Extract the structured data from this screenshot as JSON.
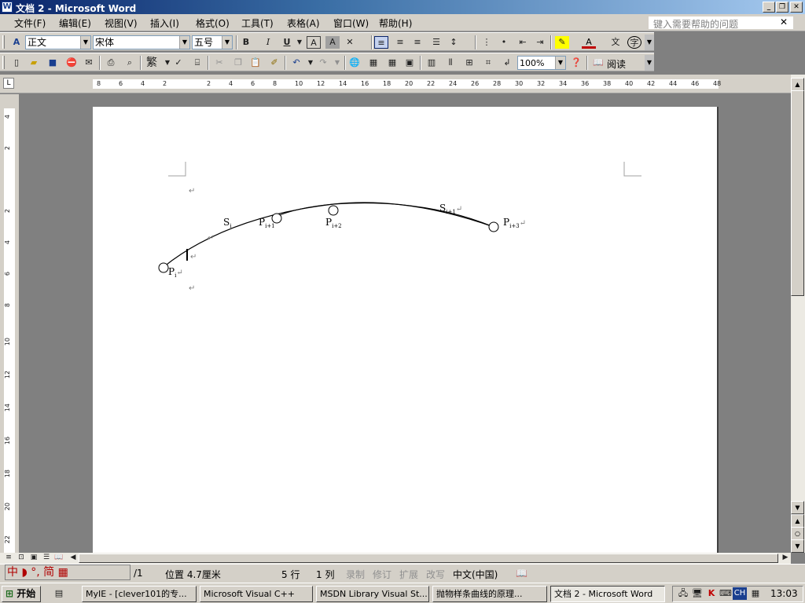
{
  "window": {
    "title": "文档 2 - Microsoft Word"
  },
  "menu": {
    "items": [
      "文件(F)",
      "编辑(E)",
      "视图(V)",
      "插入(I)",
      "格式(O)",
      "工具(T)",
      "表格(A)",
      "窗口(W)",
      "帮助(H)"
    ],
    "help_placeholder": "键入需要帮助的问题"
  },
  "format_toolbar": {
    "style": "正文",
    "font": "宋体",
    "size": "五号",
    "bold": "B",
    "italic": "I",
    "underline": "U"
  },
  "std_toolbar": {
    "zoom": "100%",
    "read": "阅读",
    "trad": "繁"
  },
  "ruler": {
    "h_ticks": [
      "8",
      "6",
      "4",
      "2",
      "2",
      "4",
      "6",
      "8",
      "10",
      "12",
      "14",
      "16",
      "18",
      "20",
      "22",
      "24",
      "26",
      "28",
      "30",
      "32",
      "34",
      "36",
      "38",
      "40",
      "42",
      "44",
      "46",
      "48"
    ],
    "v_ticks": [
      "4",
      "2",
      "2",
      "4",
      "6",
      "8",
      "10",
      "12",
      "14",
      "16",
      "18",
      "20",
      "22"
    ]
  },
  "document": {
    "labels": {
      "pi": "P",
      "pi_sub": "i",
      "pi1": "P",
      "pi1_sub": "i+1",
      "pi2": "P",
      "pi2_sub": "i+2",
      "pi3": "P",
      "pi3_sub": "i+3",
      "si": "S",
      "si_sub": "i",
      "si1": "S",
      "si1_sub": "i+1"
    },
    "para_mark": "↵"
  },
  "status": {
    "page": "/1",
    "position": "位置 4.7厘米",
    "line": "5 行",
    "col": "1 列",
    "rec": "录制",
    "trk": "修订",
    "ext": "扩展",
    "ovr": "改写",
    "lang": "中文(中国)"
  },
  "ime": {
    "text": "中 ◗ °, 简 ▦"
  },
  "taskbar": {
    "start": "开始",
    "tasks": [
      "MyIE - [clever101的专...",
      "Microsoft Visual C++",
      "MSDN Library Visual St...",
      "抛物样条曲线的原理...",
      "文档 2 - Microsoft Word"
    ],
    "clock": "13:03",
    "tray_lang": "CH"
  }
}
